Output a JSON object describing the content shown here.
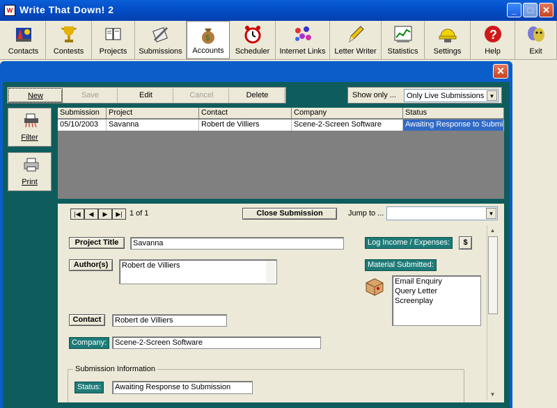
{
  "app": {
    "title": "Write That Down! 2",
    "icon_letters": "W"
  },
  "window_controls": {
    "minimize": "_",
    "maximize": "□",
    "close": "✕"
  },
  "toolbar": {
    "items": [
      {
        "label": "Contacts",
        "icon": "contacts-icon"
      },
      {
        "label": "Contests",
        "icon": "trophy-icon"
      },
      {
        "label": "Projects",
        "icon": "book-icon"
      },
      {
        "label": "Submissions",
        "icon": "submissions-icon"
      },
      {
        "label": "Accounts",
        "icon": "money-bag-icon"
      },
      {
        "label": "Scheduler",
        "icon": "alarm-clock-icon"
      },
      {
        "label": "Internet Links",
        "icon": "globe-links-icon"
      },
      {
        "label": "Letter Writer",
        "icon": "pencil-icon"
      },
      {
        "label": "Statistics",
        "icon": "chart-icon"
      },
      {
        "label": "Settings",
        "icon": "hard-hat-icon"
      },
      {
        "label": "Help",
        "icon": "question-icon"
      },
      {
        "label": "Exit",
        "icon": "masks-icon"
      }
    ],
    "active": "Accounts"
  },
  "actions": {
    "new": "New",
    "save": "Save",
    "edit": "Edit",
    "cancel": "Cancel",
    "delete": "Delete"
  },
  "filter": {
    "show_only_label": "Show only ...",
    "show_only_value": "Only Live Submissions"
  },
  "side": {
    "filter": "Filter",
    "print": "Print"
  },
  "grid": {
    "columns": [
      "Submission",
      "Project",
      "Contact",
      "Company",
      "Status"
    ],
    "rows": [
      [
        "05/10/2003",
        "Savanna",
        "Robert de Villiers",
        "Scene-2-Screen Software",
        "Awaiting Response to Submis"
      ]
    ]
  },
  "record_nav": {
    "position": "1 of 1",
    "close_submission": "Close Submission",
    "jump_to": "Jump to ...",
    "jump_value": ""
  },
  "form": {
    "project_title_label": "Project Title",
    "project_title": "Savanna",
    "authors_label": "Author(s)",
    "authors": "Robert de Villiers",
    "contact_label": "Contact",
    "contact": "Robert de Villiers",
    "company_label": "Company:",
    "company": "Scene-2-Screen Software",
    "log_income_label": "Log Income / Expenses:",
    "dollar_button": "$",
    "material_label": "Material Submitted:",
    "materials": [
      "Email Enquiry",
      "Query Letter",
      "Screenplay"
    ],
    "submission_info_label": "Submission Information",
    "status_label": "Status:",
    "status": "Awaiting Response to Submission"
  }
}
